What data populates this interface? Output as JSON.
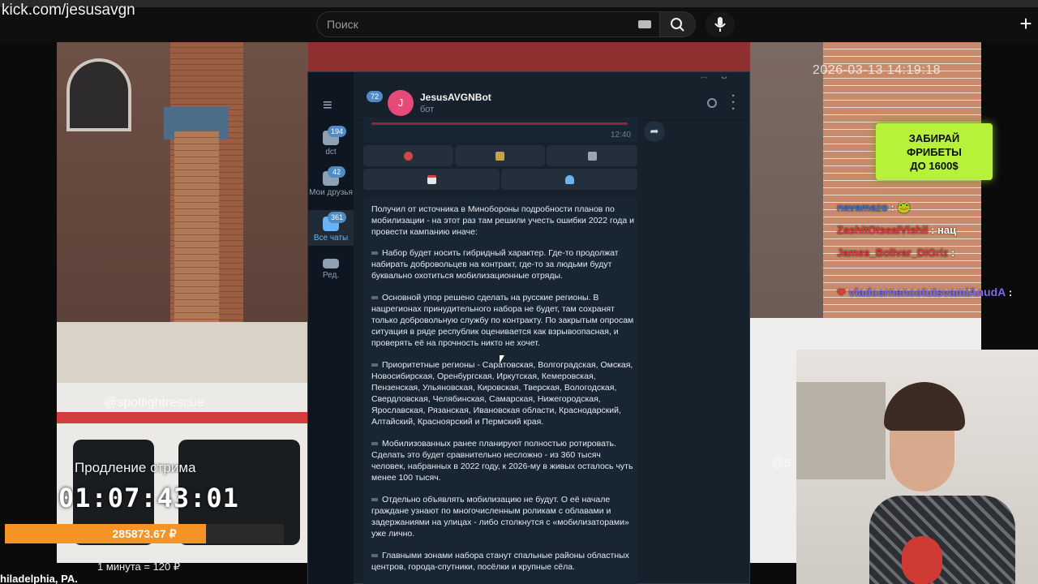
{
  "browser": {
    "url_overlay": "kick.com/jesusavgn",
    "search_placeholder": "Поиск",
    "icons": [
      "keyboard-icon",
      "search-icon",
      "mic-icon",
      "plus-icon"
    ]
  },
  "stream": {
    "timestamp": "2026-03-13 14:19:18",
    "watermark": "@spotlightrescue",
    "watermark_right": "@s",
    "extension_label": "Продление стрима",
    "extension_timer": "01:07:43:01",
    "donate_total": "285873.67 ₽",
    "donate_progress": 0.72,
    "rate": "1 минута = 120 ₽",
    "location": "hiladelphia, PA.",
    "promo": "ЗАБИРАЙ\nФРИБЕТЫ\nДО 1600$",
    "chat": [
      {
        "user": "navamazo",
        "text": ": 🐸",
        "color": "#3f6fd8"
      },
      {
        "user": "ZashitOtsealVishil",
        "text": ": нац",
        "color": "#e23a3a"
      },
      {
        "user": "James_Bolivar_DiGriz",
        "text": ":",
        "color": "#e23a3a"
      },
      {
        "user": "vladcernencotutsvamiAnudA",
        "text": ":",
        "color": "#7d6cf0"
      }
    ]
  },
  "telegram": {
    "rail": [
      {
        "label": "dct",
        "badge": "194"
      },
      {
        "label": "Мои друзья",
        "badge": "42"
      },
      {
        "label": "Все чаты",
        "badge": "361",
        "active": true
      },
      {
        "label": "Ред.",
        "badge": ""
      }
    ],
    "header": {
      "back_badge": "72",
      "avatar_letter": "J",
      "bot_name": "JesusAVGNBot",
      "bot_status": "бот"
    },
    "prev_message_time": "12:40",
    "keyboard": {
      "row1": [
        "stop-icon",
        "broom-icon",
        "trash-icon"
      ],
      "row2": [
        "calendar-icon",
        "user-icon"
      ]
    },
    "message": {
      "intro": "Получил от источника в Минобороны подробности планов по мобилизации - на этот раз там решили учесть ошибки 2022 года и провести кампанию иначе:",
      "points": [
        "Набор будет носить гибридный характер. Где-то продолжат набирать добровольцев на контракт, где-то за людьми будут буквально охотиться мобилизационные отряды.",
        "Основной упор решено сделать на русские регионы. В нацрегионах принудительного набора не будет, там сохранят только добровольную службу по контракту. По закрытым опросам ситуация в ряде республик оценивается как взрывоопасная, и проверять её на прочность никто не хочет.",
        "Приоритетные регионы - Саратовская, Волгоградская, Омская, Новосибирская, Оренбургская, Иркутская, Кемеровская, Пензенская, Ульяновская, Кировская, Тверская, Вологодская, Свердловская, Челябинская, Самарская, Нижегородская, Ярославская, Рязанская, Ивановская области, Краснодарский, Алтайский, Красноярский и Пермский края.",
        "Мобилизованных ранее планируют полностью ротировать. Сделать это будет сравнительно несложно - из 360 тысяч человек, набранных в 2022 году, к 2026-му в живых осталось чуть менее 100 тысяч.",
        "Отдельно объявлять мобилизацию не будут. О её начале граждане узнают по многочисленным роликам с облавами и задержаниями на улицах - либо столкнутся с «мобилизаторами» уже лично.",
        "Главными зонами набора станут спальные районы областных центров, города-спутники, посёлки и крупные сёла."
      ]
    }
  },
  "colors": {
    "tg_bg": "#17212b",
    "tg_rail": "#0e1621",
    "tg_accent": "#6ab2f2",
    "donate_fill": "#f59324",
    "promo": "#b6f23a"
  }
}
